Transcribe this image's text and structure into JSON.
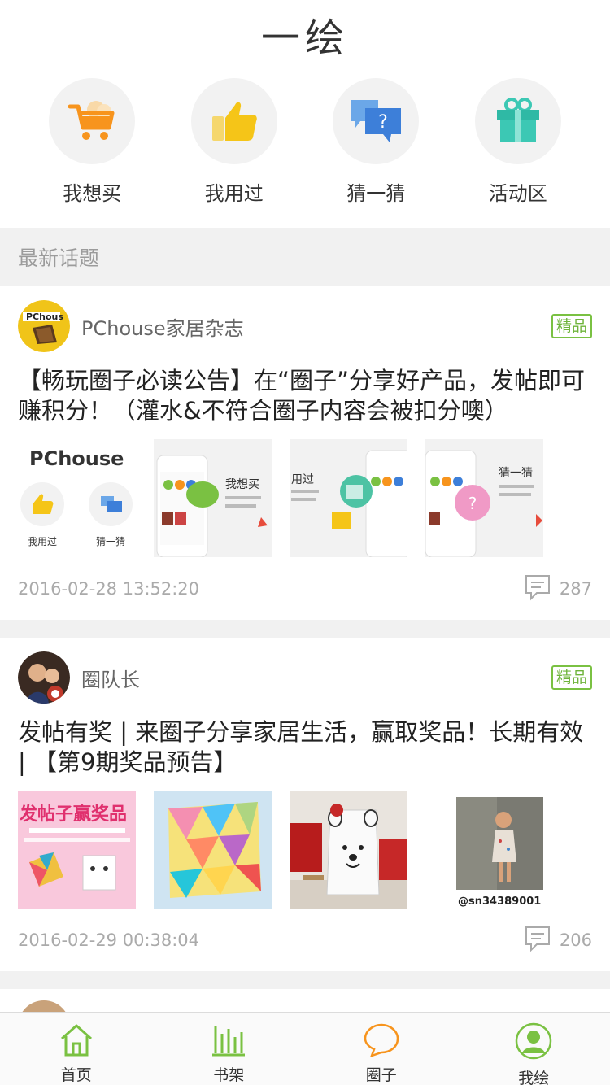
{
  "header": {
    "title": "一绘"
  },
  "shortcuts": [
    {
      "label": "我想买",
      "icon": "shopping-cart-icon"
    },
    {
      "label": "我用过",
      "icon": "thumbs-up-icon"
    },
    {
      "label": "猜一猜",
      "icon": "question-chat-icon"
    },
    {
      "label": "活动区",
      "icon": "gift-icon"
    }
  ],
  "section": {
    "title": "最新话题"
  },
  "posts": [
    {
      "author": "PChouse家居杂志",
      "badge": "精品",
      "title": "【畅玩圈子必读公告】在“圈子”分享好产品，发帖即可赚积分！（灌水&不符合圈子内容会被扣分噢）",
      "timestamp": "2016-02-28 13:52:20",
      "comments": "287",
      "thumb_texts": {
        "brand": "PChouse",
        "used": "我用过",
        "guess": "猜一猜",
        "want": "我想买",
        "used_short": "用过",
        "guess2": "猜一猜"
      }
    },
    {
      "author": "圈队长",
      "badge": "精品",
      "title": "发帖有奖 | 来圈子分享家居生活，赢取奖品！长期有效 | 【第9期奖品预告】",
      "timestamp": "2016-02-29 00:38:04",
      "comments": "206",
      "thumb_texts": {
        "banner": "发帖子赢奖品",
        "tag": "@sn34389001"
      }
    }
  ],
  "tabbar": [
    {
      "label": "首页",
      "icon": "home-icon",
      "active": true
    },
    {
      "label": "书架",
      "icon": "bookshelf-icon",
      "active": false
    },
    {
      "label": "圈子",
      "icon": "chat-bubble-icon",
      "active": false
    },
    {
      "label": "我绘",
      "icon": "user-profile-icon",
      "active": false
    }
  ],
  "colors": {
    "accent_green": "#6fb43b",
    "orange": "#f7941d",
    "separator": "#f1f1f1"
  }
}
